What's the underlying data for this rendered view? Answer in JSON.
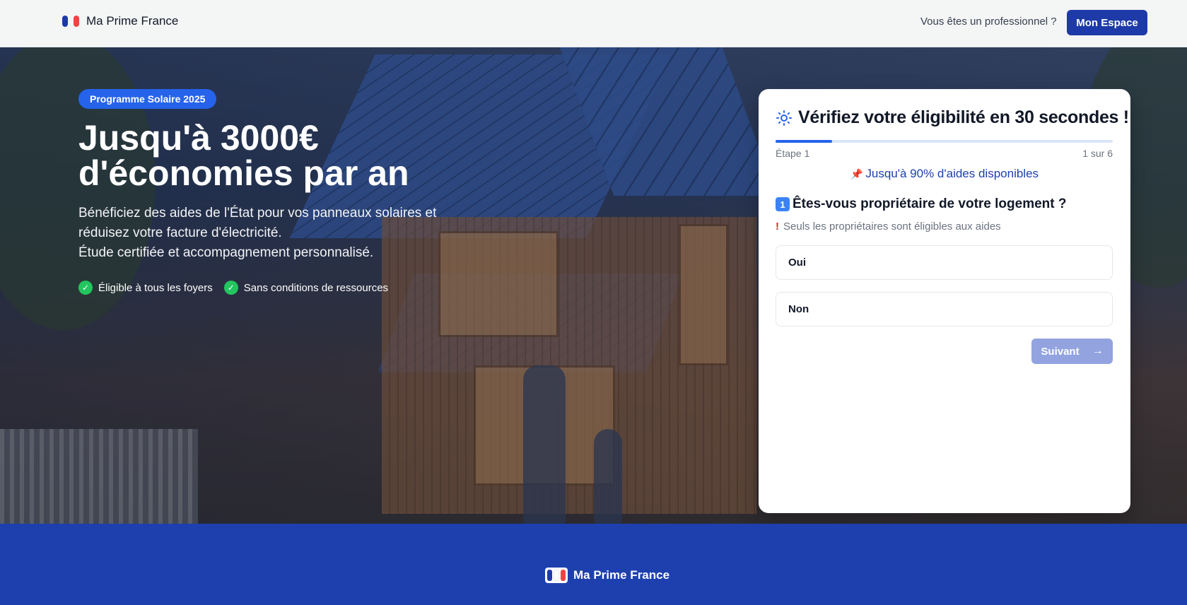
{
  "header": {
    "brand_name": "Ma Prime France",
    "pro_link": "Vous êtes un professionnel ?",
    "espace_button": "Mon Espace",
    "flag_colors": [
      "#1d3aa8",
      "#ef4444"
    ]
  },
  "hero": {
    "badge": "Programme Solaire 2025",
    "title_line1": "Jusqu'à 3000€",
    "title_line2": "d'économies par an",
    "subtitle_line1": "Bénéficiez des aides de l'État pour vos panneaux solaires et",
    "subtitle_line2": "réduisez votre facture d'électricité.",
    "subtitle_line3": "Étude certifiée et accompagnement personnalisé.",
    "checks": [
      {
        "label": "Éligible à tous les foyers",
        "icon": "check-icon"
      },
      {
        "label": "Sans conditions de ressources",
        "icon": "check-icon"
      }
    ]
  },
  "form": {
    "title": "Vérifiez votre éligibilité en 30 secondes !",
    "title_icon": "sun-icon",
    "progress_fraction": 0.167,
    "step_label": "Étape 1",
    "step_count": "1 sur 6",
    "aid_text": "Jusqu'à 90% d'aides disponibles",
    "aid_icon": "📌",
    "question_number": "1",
    "question": "Êtes-vous propriétaire de votre logement ?",
    "warning_icon": "!",
    "warning": "Seuls les propriétaires sont éligibles aux aides",
    "options": [
      "Oui",
      "Non"
    ],
    "next_button": "Suivant",
    "accent": "#2563eb"
  },
  "footer": {
    "brand_name": "Ma Prime France",
    "background": "#1e40af"
  }
}
